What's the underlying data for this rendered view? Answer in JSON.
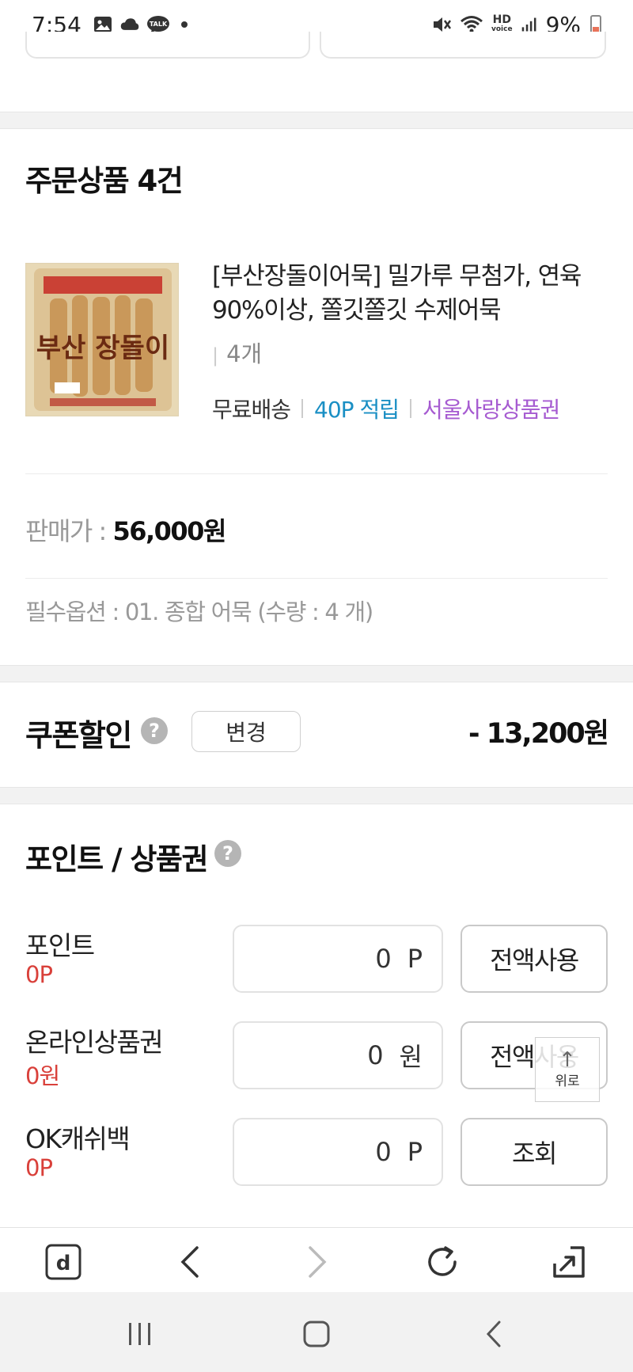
{
  "status_bar": {
    "time": "7:54",
    "battery": "9%",
    "talk_badge": "TALK",
    "hd_label": "HD"
  },
  "order_section": {
    "title": "주문상품 4건"
  },
  "product": {
    "title": "[부산장돌이어묵] 밀가루 무첨가, 연육 90%이상, 쫄깃쫄깃 수제어묵",
    "quantity": "4개",
    "tags": {
      "shipping": "무료배송",
      "points": "40P 적립",
      "voucher": "서울사랑상품권"
    },
    "price_label": "판매가 : ",
    "price_value": "56,000원",
    "option": "필수옵션 : 01. 종합 어묵 (수량 : 4 개)",
    "image_text": "부산 장돌이"
  },
  "coupon": {
    "title": "쿠폰할인",
    "help": "?",
    "change_label": "변경",
    "amount": "- 13,200원"
  },
  "points_section": {
    "title": "포인트 / 상품권",
    "help": "?",
    "rows": [
      {
        "label": "포인트",
        "balance": "0P",
        "value": "0",
        "unit": "P",
        "button": "전액사용"
      },
      {
        "label": "온라인상품권",
        "balance": "0원",
        "value": "0",
        "unit": "원",
        "button": "전액사용"
      },
      {
        "label": "OK캐쉬백",
        "balance": "0P",
        "value": "0",
        "unit": "P",
        "button": "조회"
      }
    ]
  },
  "float_top": {
    "label": "위로"
  },
  "browser_toolbar": {
    "items": [
      "home-d-icon",
      "back-icon",
      "forward-icon",
      "reload-icon",
      "share-icon"
    ]
  },
  "colors": {
    "point_blue": "#1a8fc4",
    "voucher_purple": "#a65bd1",
    "balance_red": "#d9403a"
  }
}
